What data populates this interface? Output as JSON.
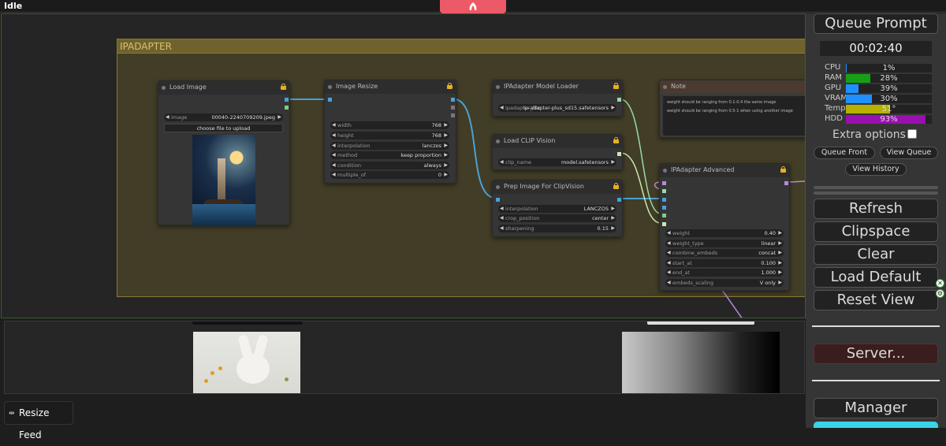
{
  "app": {
    "status": "Idle"
  },
  "group": {
    "title": "IPADAPTER"
  },
  "nodes": {
    "load_image": {
      "title": "Load Image",
      "image_label": "image",
      "image_value": "00040-2240709209.jpeg",
      "upload_label": "choose file to upload"
    },
    "image_resize": {
      "title": "Image Resize",
      "widgets": [
        {
          "label": "width",
          "value": "768"
        },
        {
          "label": "height",
          "value": "768"
        },
        {
          "label": "interpolation",
          "value": "lanczos"
        },
        {
          "label": "method",
          "value": "keep proportion"
        },
        {
          "label": "condition",
          "value": "always"
        },
        {
          "label": "multiple_of",
          "value": "0"
        }
      ]
    },
    "ipadapter_loader": {
      "title": "IPAdapter Model Loader",
      "widget": {
        "label": "ipadapter_file",
        "value": "ip-adapter-plus_sd15.safetensors"
      }
    },
    "clip_vision": {
      "title": "Load CLIP Vision",
      "widget": {
        "label": "clip_name",
        "value": "model.safetensors"
      }
    },
    "prep_image": {
      "title": "Prep Image For ClipVision",
      "widgets": [
        {
          "label": "interpolation",
          "value": "LANCZOS"
        },
        {
          "label": "crop_position",
          "value": "center"
        },
        {
          "label": "sharpening",
          "value": "0.15"
        }
      ]
    },
    "note": {
      "title": "Note",
      "lines": [
        "weight should be ranging from 0.1-0.4 the same image",
        "weight should be ranging from 0.5-1 when using another image"
      ]
    },
    "ipadapter_advanced": {
      "title": "IPAdapter Advanced",
      "widgets": [
        {
          "label": "weight",
          "value": "0.40"
        },
        {
          "label": "weight_type",
          "value": "linear"
        },
        {
          "label": "combine_embeds",
          "value": "concat"
        },
        {
          "label": "start_at",
          "value": "0.100"
        },
        {
          "label": "end_at",
          "value": "1.000"
        },
        {
          "label": "embeds_scaling",
          "value": "V only"
        }
      ]
    }
  },
  "feed": {
    "resize_label": "Resize Feed"
  },
  "sidebar": {
    "queue_prompt": "Queue Prompt",
    "timer": "00:02:40",
    "stats": [
      {
        "label": "CPU",
        "value": "1%",
        "level": 0.01,
        "color": "#1e90ff"
      },
      {
        "label": "RAM",
        "value": "28%",
        "level": 0.28,
        "color": "#16a016"
      },
      {
        "label": "GPU",
        "value": "39%",
        "level": 0.15,
        "color": "#1e90ff"
      },
      {
        "label": "VRAM",
        "value": "30%",
        "level": 0.3,
        "color": "#1e90ff"
      },
      {
        "label": "Temp",
        "value": "51°",
        "level": 0.51,
        "color": "#b8b000"
      },
      {
        "label": "HDD",
        "value": "93%",
        "level": 0.93,
        "color": "#9a0fb0"
      }
    ],
    "extra_options": "Extra options",
    "queue_front": "Queue Front",
    "view_queue": "View Queue",
    "view_history": "View History",
    "refresh": "Refresh",
    "clipspace": "Clipspace",
    "clear": "Clear",
    "load_default": "Load Default",
    "reset_view": "Reset View",
    "server": "Server...",
    "manager": "Manager"
  }
}
